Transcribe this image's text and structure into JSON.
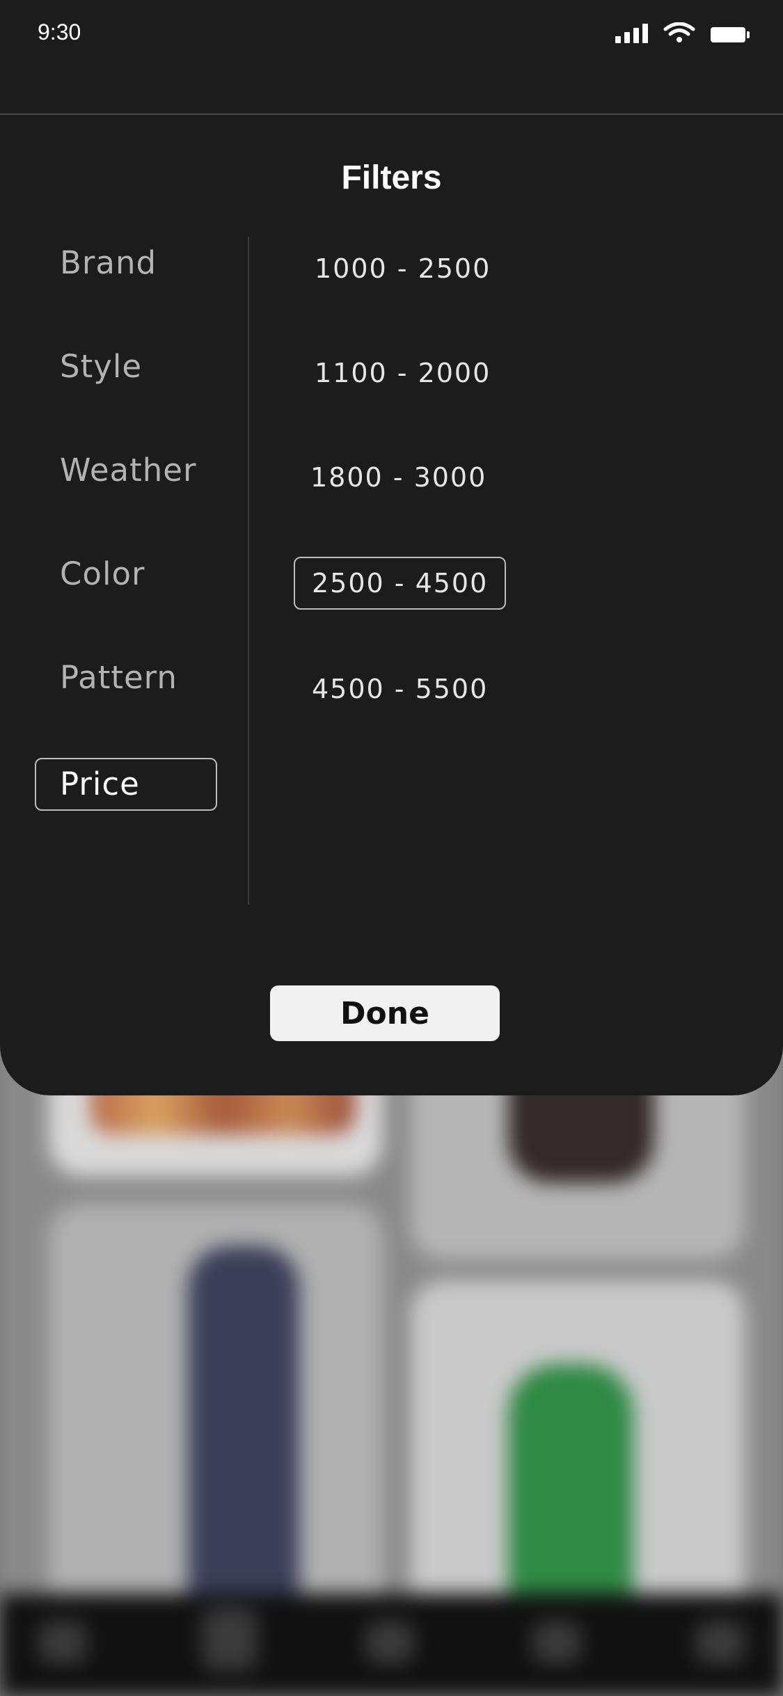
{
  "status_bar": {
    "time": "9:30"
  },
  "filters": {
    "title": "Filters",
    "categories": [
      {
        "label": "Brand"
      },
      {
        "label": "Style"
      },
      {
        "label": "Weather"
      },
      {
        "label": "Color"
      },
      {
        "label": "Pattern"
      },
      {
        "label": "Price",
        "selected": true
      }
    ],
    "price_options": [
      {
        "label": "1000 - 2500"
      },
      {
        "label": "1100 - 2000"
      },
      {
        "label": "1800 - 3000"
      },
      {
        "label": "2500 - 4500",
        "selected": true
      },
      {
        "label": "4500 - 5500"
      }
    ],
    "done_label": "Done"
  },
  "colors": {
    "sheet_background": "#1c1c1c",
    "selected_border": "#bdbdbd",
    "done_button": "#f1f1f1"
  }
}
